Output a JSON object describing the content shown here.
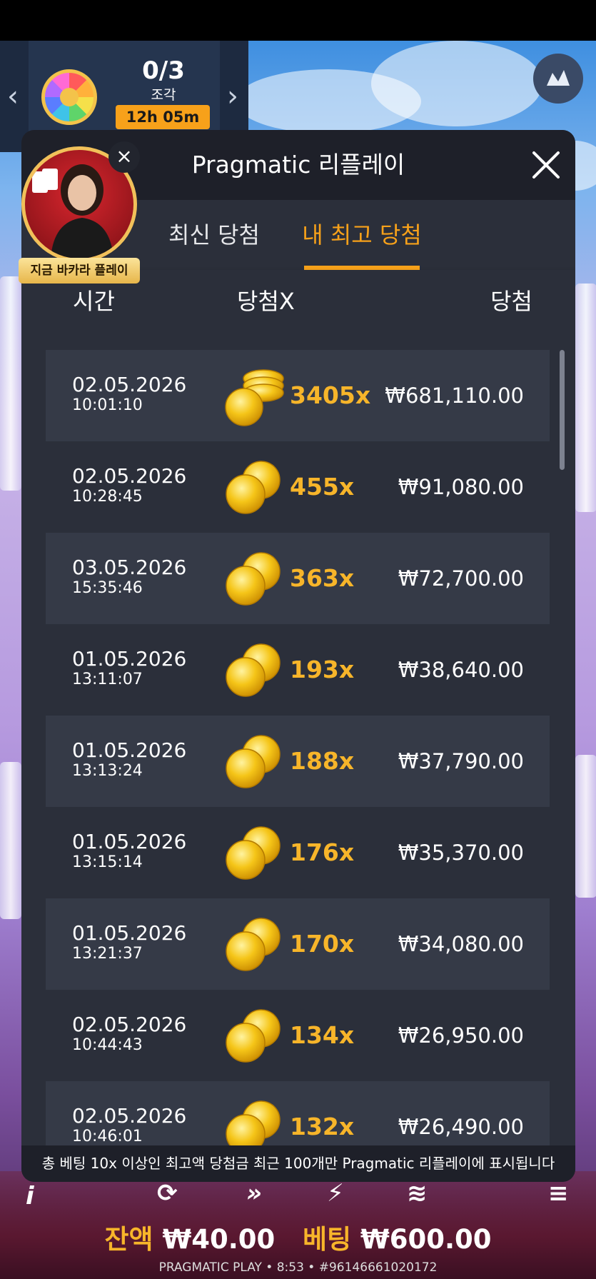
{
  "top_panel": {
    "progress_fraction": "0/3",
    "progress_label": "조각",
    "timer": "12h 05m",
    "left_arrow": "‹",
    "right_arrow": "›"
  },
  "promo": {
    "label": "지금 바카라 플레이",
    "close": "×"
  },
  "modal": {
    "title": "Pragmatic 리플레이",
    "tabs": [
      {
        "label": "최신 당첨",
        "active": false
      },
      {
        "label": "내 최고 당첨",
        "active": true
      }
    ],
    "columns": {
      "time": "시간",
      "multiplier": "당첨X",
      "win": "당첨"
    },
    "rows": [
      {
        "date": "02.05.2026",
        "time": "10:01:10",
        "multiplier": "3405x",
        "amount": "₩681,110.00",
        "icon": "coin-stack-icon"
      },
      {
        "date": "02.05.2026",
        "time": "10:28:45",
        "multiplier": "455x",
        "amount": "₩91,080.00",
        "icon": "coins-icon"
      },
      {
        "date": "03.05.2026",
        "time": "15:35:46",
        "multiplier": "363x",
        "amount": "₩72,700.00",
        "icon": "coins-icon"
      },
      {
        "date": "01.05.2026",
        "time": "13:11:07",
        "multiplier": "193x",
        "amount": "₩38,640.00",
        "icon": "coins-icon"
      },
      {
        "date": "01.05.2026",
        "time": "13:13:24",
        "multiplier": "188x",
        "amount": "₩37,790.00",
        "icon": "coins-icon"
      },
      {
        "date": "01.05.2026",
        "time": "13:15:14",
        "multiplier": "176x",
        "amount": "₩35,370.00",
        "icon": "coins-icon"
      },
      {
        "date": "01.05.2026",
        "time": "13:21:37",
        "multiplier": "170x",
        "amount": "₩34,080.00",
        "icon": "coins-icon"
      },
      {
        "date": "02.05.2026",
        "time": "10:44:43",
        "multiplier": "134x",
        "amount": "₩26,950.00",
        "icon": "coins-icon"
      },
      {
        "date": "02.05.2026",
        "time": "10:46:01",
        "multiplier": "132x",
        "amount": "₩26,490.00",
        "icon": "coins-icon"
      }
    ],
    "footer_note": "총 베팅 10x 이상인 최고액 당첨금 최근 100개만 Pragmatic 리플레이에 표시됩니다"
  },
  "game_ui": {
    "balance_label": "잔액",
    "balance_value": "₩40.00",
    "bet_label": "베팅",
    "bet_value": "₩600.00",
    "provider_line": "PRAGMATIC PLAY • 8:53 • #96146661020172",
    "info_glyph": "i"
  },
  "colors": {
    "accent": "#f7a11a",
    "multiplier": "#f7b52a",
    "modal_bg": "#2b2f3a",
    "row_alt": "#353a47"
  }
}
